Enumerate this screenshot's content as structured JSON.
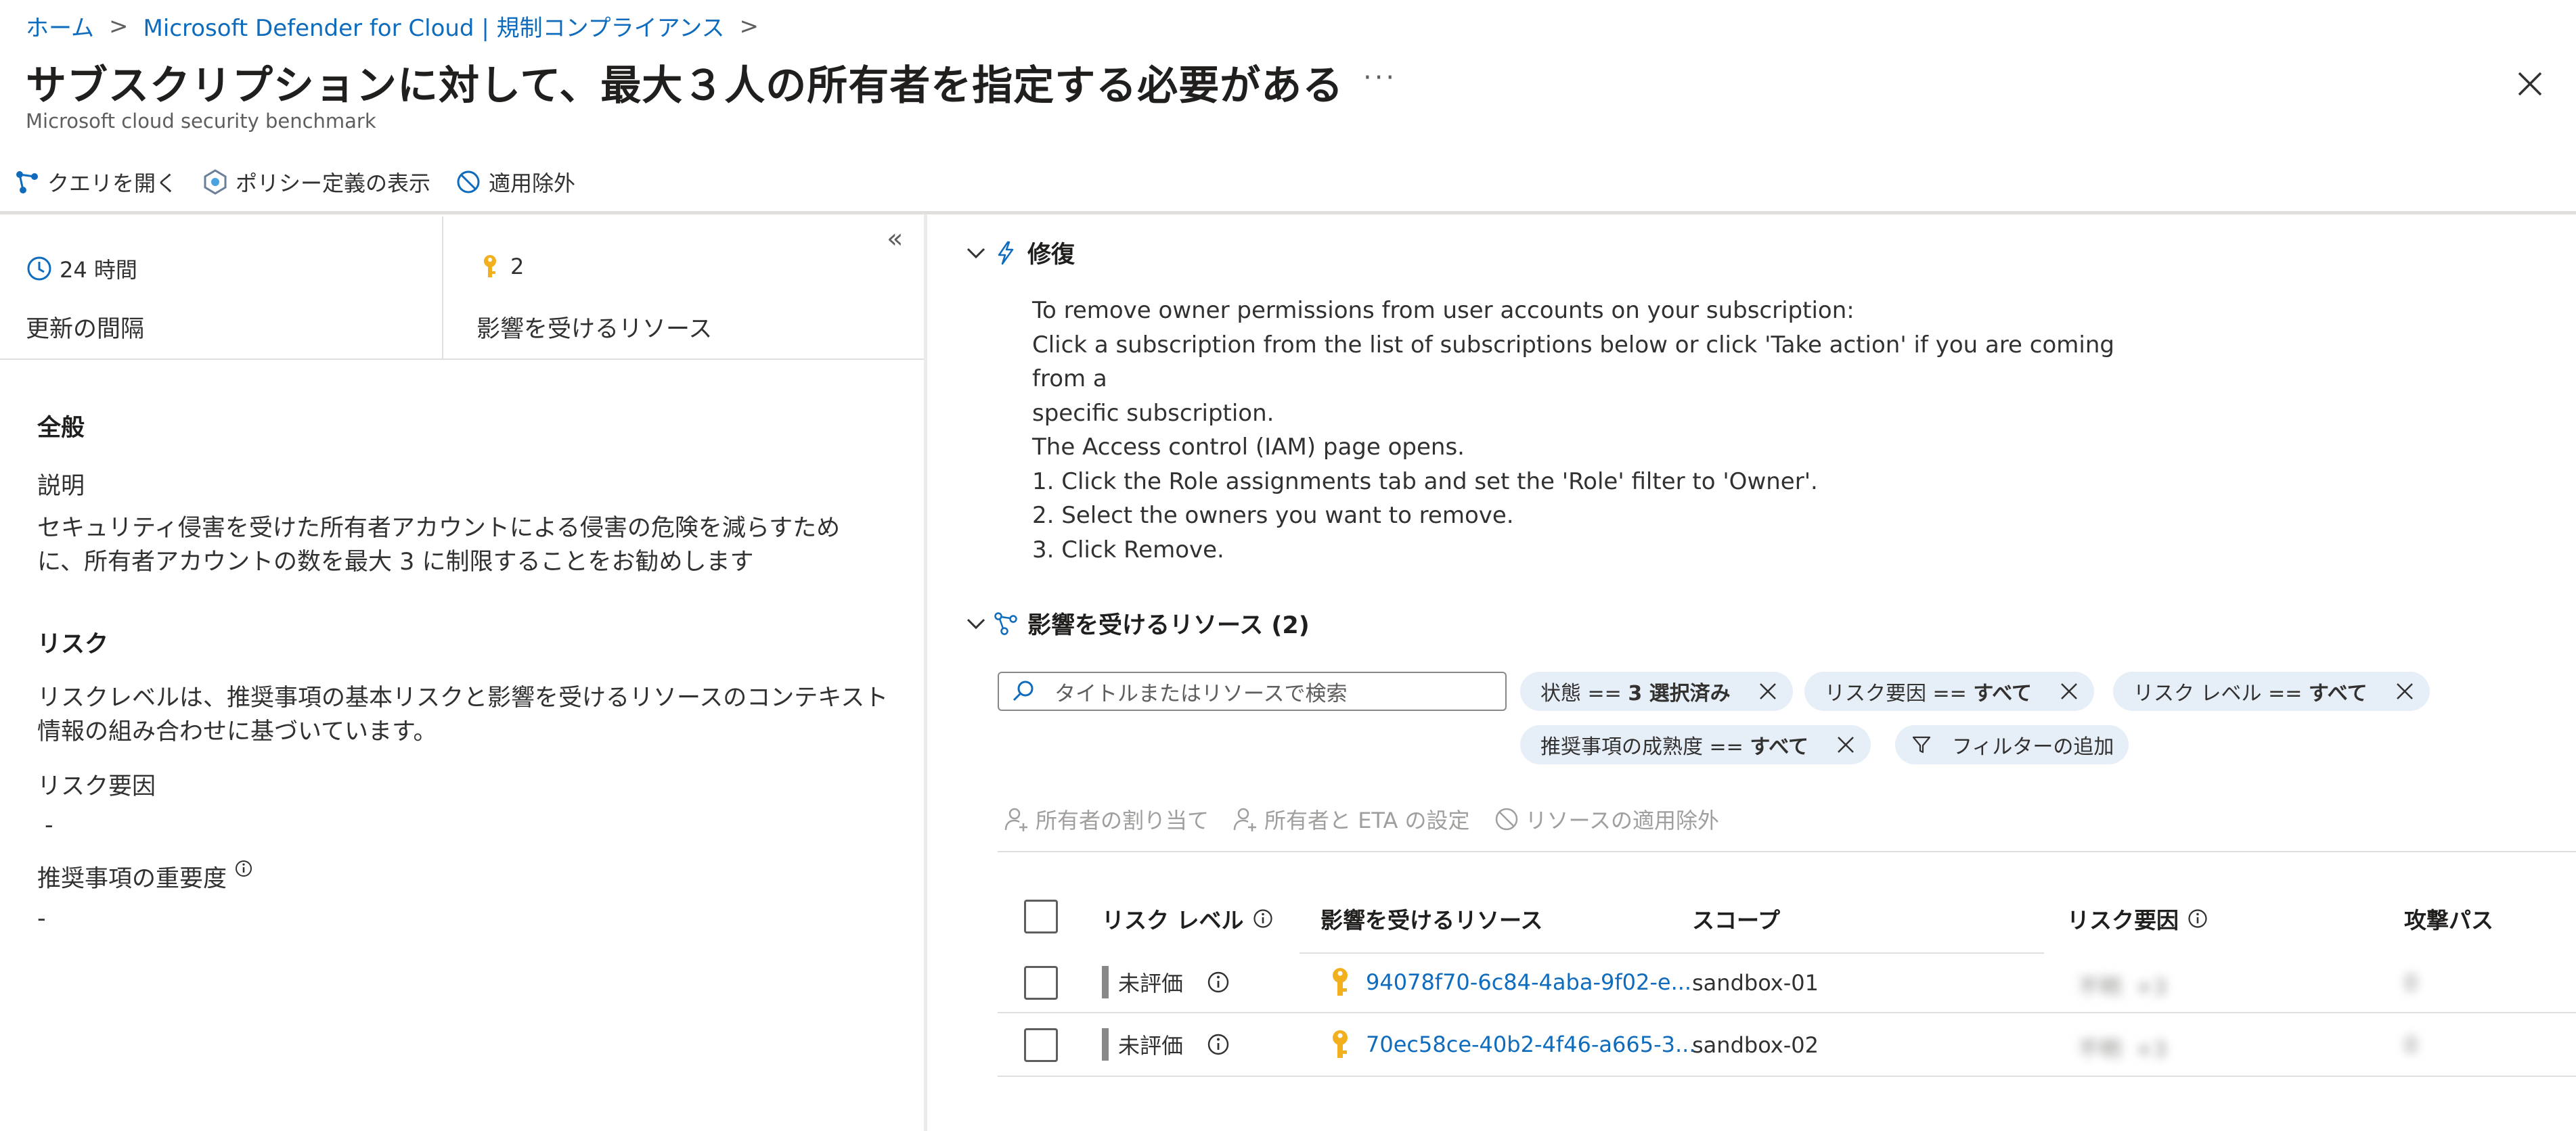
{
  "breadcrumb": {
    "home": "ホーム",
    "parent": "Microsoft Defender for Cloud | 規制コンプライアンス"
  },
  "header": {
    "title": "サブスクリプションに対して、最大３人の所有者を指定する必要がある",
    "more": "···",
    "subtitle": "Microsoft cloud security benchmark"
  },
  "toolbar": {
    "open_query": "クエリを開く",
    "view_policy": "ポリシー定義の表示",
    "exempt": "適用除外"
  },
  "stats": {
    "interval_value": "24 時間",
    "interval_label": "更新の間隔",
    "resources_value": "2",
    "resources_label": "影響を受けるリソース"
  },
  "general": {
    "heading": "全般",
    "desc_label": "説明",
    "desc_line1": "セキュリティ侵害を受けた所有者アカウントによる侵害の危険を減らすため",
    "desc_line2": "に、所有者アカウントの数を最大 3 に制限することをお勧めします"
  },
  "risk": {
    "heading": "リスク",
    "text_line1": "リスクレベルは、推奨事項の基本リスクと影響を受けるリソースのコンテキスト",
    "text_line2": "情報の組み合わせに基づいています。",
    "factors_label": "リスク要因",
    "factors_value": "-",
    "severity_label": "推奨事項の重要度",
    "severity_value": "-"
  },
  "remediation": {
    "title": "修復",
    "lines": [
      "To remove owner permissions from user accounts on your subscription:",
      "Click a subscription from the list of subscriptions below or click 'Take action' if you are coming from a",
      "specific subscription.",
      "The Access control (IAM) page opens.",
      "1. Click the Role assignments tab and set the 'Role' filter to 'Owner'.",
      "2. Select the owners you want to remove.",
      "3. Click Remove."
    ]
  },
  "affected": {
    "title": "影響を受けるリソース (2)",
    "search_placeholder": "タイトルまたはリソースで検索",
    "filters": {
      "state_label": "状態 == ",
      "state_value": "3 選択済み",
      "factor_label": "リスク要因 == ",
      "factor_value": "すべて",
      "level_label": "リスク レベル == ",
      "level_value": "すべて",
      "maturity_label": "推奨事項の成熟度 == ",
      "maturity_value": "すべて",
      "add_filter": "フィルターの追加"
    },
    "actions": {
      "assign_owner": "所有者の割り当て",
      "set_owner_eta": "所有者と ETA の設定",
      "exempt_resource": "リソースの適用除外"
    },
    "columns": {
      "risk_level": "リスク レベル",
      "resource": "影響を受けるリソース",
      "scope": "スコープ",
      "risk_factors": "リスク要因",
      "attack_path": "攻撃パス"
    },
    "rows": [
      {
        "risk": "未評価",
        "resource": "94078f70-6c84-4aba-9f02-e...",
        "scope": "sandbox-01",
        "factor_a": "不明",
        "factor_b": "+3",
        "attack": "0"
      },
      {
        "risk": "未評価",
        "resource": "70ec58ce-40b2-4f46-a665-3...",
        "scope": "sandbox-02",
        "factor_a": "不明",
        "factor_b": "+3",
        "attack": "0"
      }
    ]
  },
  "colors": {
    "link": "#0f6cbd",
    "pill_bg": "#e6eef8",
    "key_gold": "#f2b01e",
    "risk_bar": "#8a8886"
  }
}
